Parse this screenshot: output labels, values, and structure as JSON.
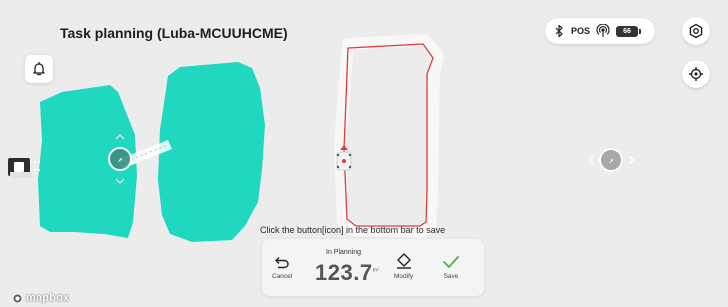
{
  "header": {
    "title": "Task planning (Luba-MCUUHCME)"
  },
  "status": {
    "bluetooth_icon": "bluetooth-icon",
    "pos_label": "POS",
    "signal_icon": "rtk-signal-icon",
    "battery_level": "66"
  },
  "buttons": {
    "settings_icon": "gear-hex-icon",
    "locate_icon": "crosshair-icon",
    "notification_icon": "bell-icon"
  },
  "hint": {
    "text": "Click the button[icon] in the bottom bar to save"
  },
  "bottom_bar": {
    "status": "In Planning",
    "area_value": "123.7",
    "area_unit": "m²",
    "cancel_label": "Cancel",
    "modify_label": "Modify",
    "save_label": "Save"
  },
  "attribution": {
    "text": "mapbox"
  },
  "colors": {
    "zone_fill": "#1fd8bf",
    "path_line": "#e53935",
    "save_check": "#4caf50"
  }
}
